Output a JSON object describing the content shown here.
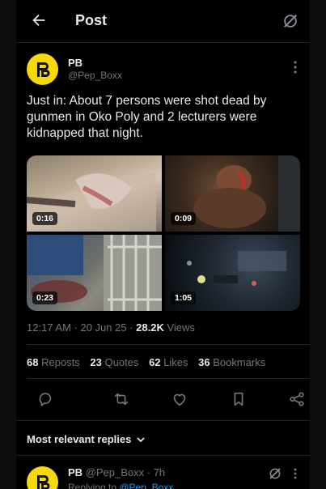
{
  "header": {
    "title": "Post"
  },
  "author": {
    "name": "PB",
    "handle": "@Pep_Boxx"
  },
  "tweet": {
    "text": "Just in: About 7 persons were shot dead by gunmen in Oko Poly and 2 lecturers were kidnapped that night.",
    "media": [
      {
        "duration": "0:16"
      },
      {
        "duration": "0:09"
      },
      {
        "duration": "0:23"
      },
      {
        "duration": "1:05"
      }
    ],
    "time": "12:17 AM · 20 Jun 25 · ",
    "views_count": "28.2K",
    "views_label": " Views"
  },
  "stats": [
    {
      "value": "68",
      "label": "Reposts"
    },
    {
      "value": "23",
      "label": "Quotes"
    },
    {
      "value": "62",
      "label": "Likes"
    },
    {
      "value": "36",
      "label": "Bookmarks"
    }
  ],
  "actions": [
    "reply-icon",
    "repost-icon",
    "like-icon",
    "bookmark-icon",
    "share-icon"
  ],
  "replies": {
    "sort_label": "Most relevant replies",
    "first": {
      "name": "PB",
      "handle_time": "@Pep_Boxx · 7h",
      "replying_prefix": "Replying to ",
      "replying_to": "@Pep_Boxx"
    }
  },
  "colors": {
    "background": "#000000",
    "avatar": "#f5d90a",
    "accent": "#1d9bf0",
    "muted": "#71767b",
    "text": "#e7e9ea"
  }
}
